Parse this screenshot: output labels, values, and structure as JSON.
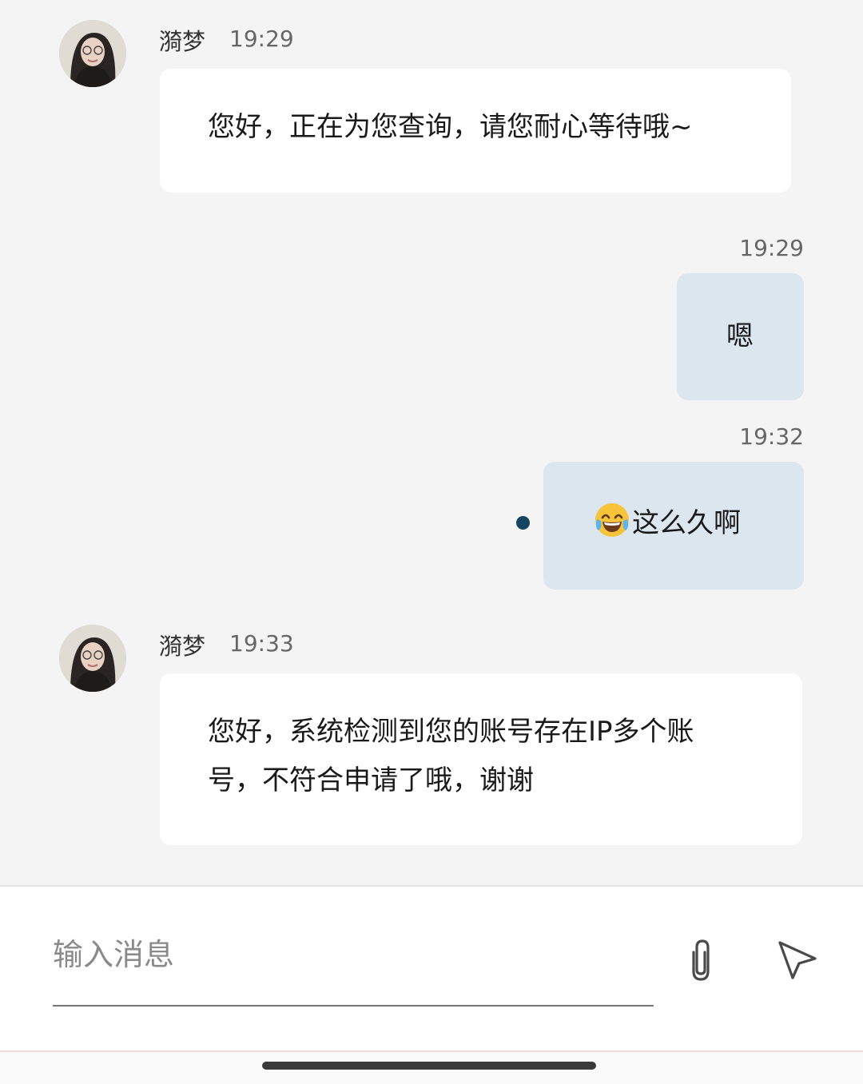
{
  "messages": [
    {
      "direction": "incoming",
      "sender": "漪梦",
      "time": "19:29",
      "lines": [
        "您好，正在为您查询，请您耐心等待哦~"
      ]
    },
    {
      "direction": "outgoing",
      "time": "19:29",
      "text": "嗯"
    },
    {
      "direction": "outgoing",
      "time": "19:32",
      "emoji": "tears-of-joy-emoji",
      "text": "这么久啊",
      "unread": true
    },
    {
      "direction": "incoming",
      "sender": "漪梦",
      "time": "19:33",
      "lines": [
        "您好，系统检测到您的账号存在IP多个账",
        "号，不符合申请了哦，谢谢"
      ]
    }
  ],
  "composer": {
    "placeholder": "输入消息",
    "attach_icon": "paperclip-icon",
    "send_icon": "send-icon"
  },
  "colors": {
    "background": "#f4f4f4",
    "incoming_bubble": "#ffffff",
    "outgoing_bubble": "#dbe6ef",
    "unread_dot": "#154560"
  }
}
